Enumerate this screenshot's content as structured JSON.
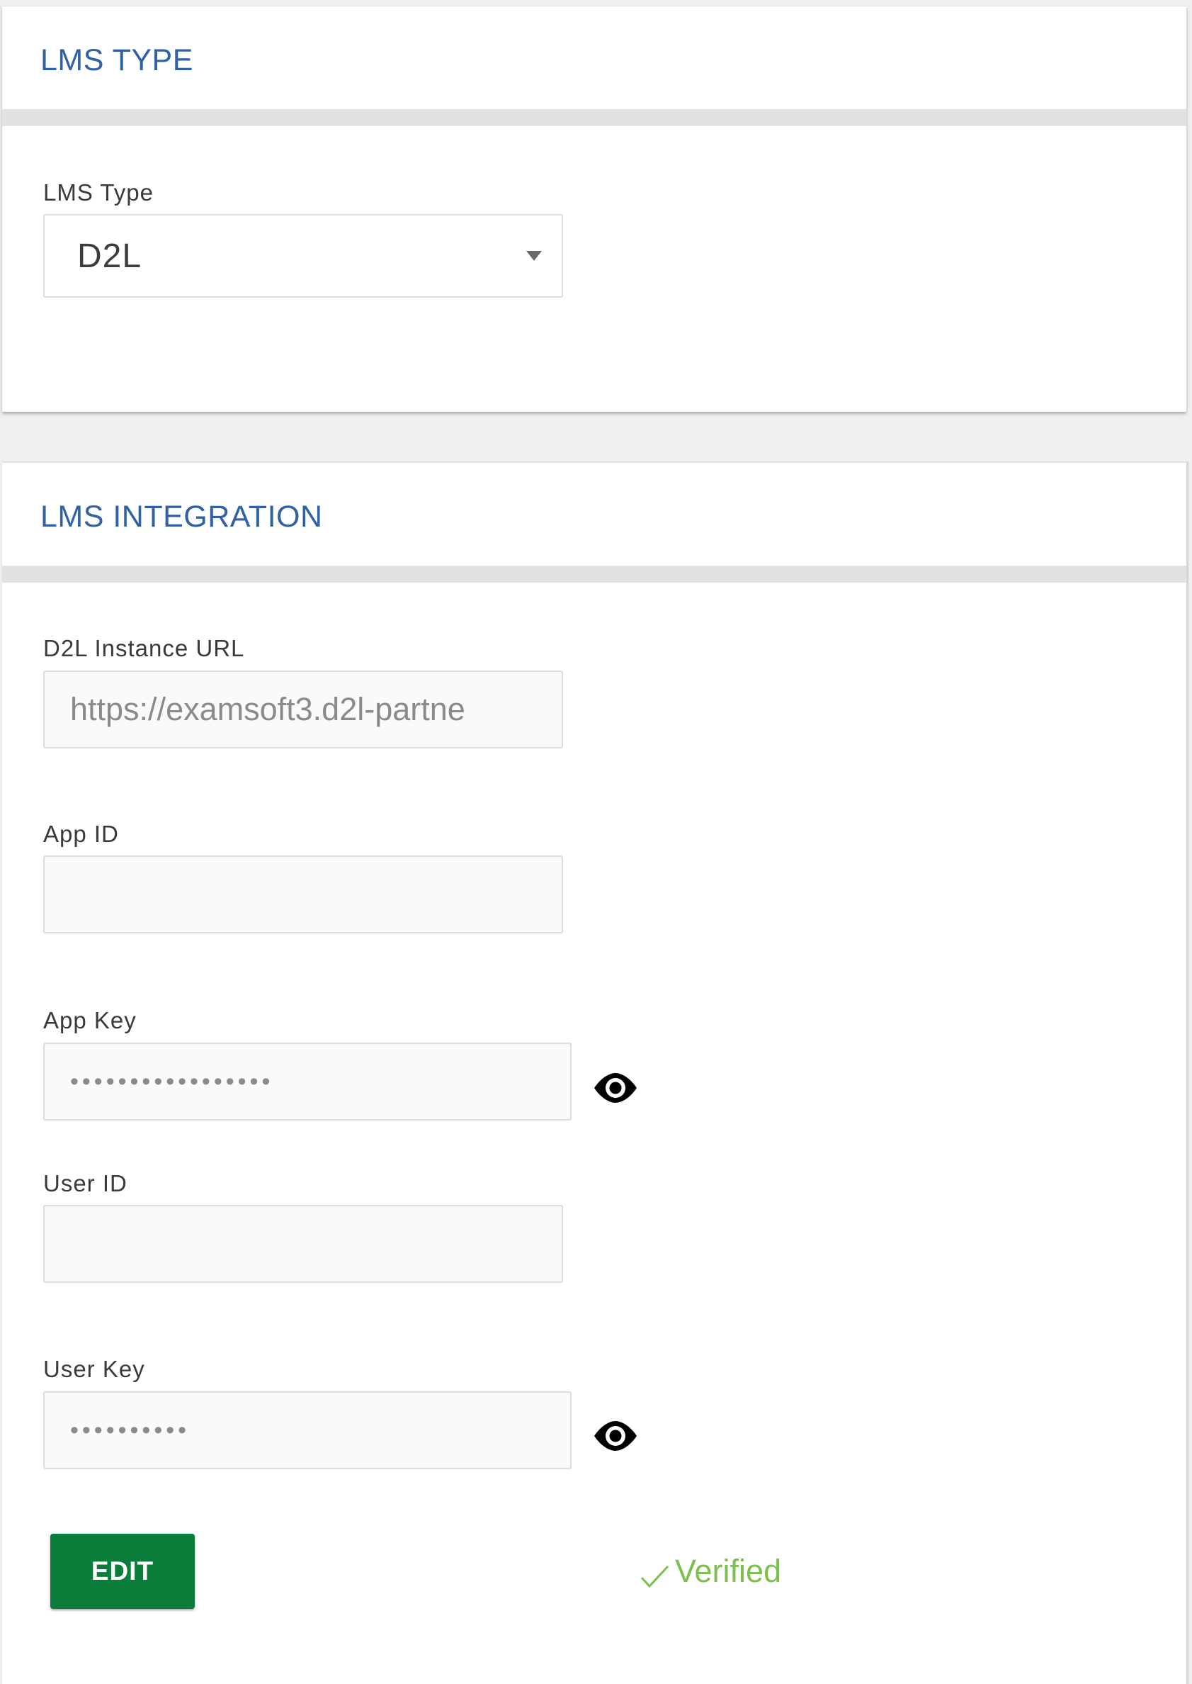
{
  "lms_type_section": {
    "title": "LMS TYPE",
    "field_label": "LMS Type",
    "selected_value": "D2L"
  },
  "lms_integration_section": {
    "title": "LMS INTEGRATION",
    "instance_url": {
      "label": "D2L Instance URL",
      "value": "https://examsoft3.d2l-partne"
    },
    "app_id": {
      "label": "App ID",
      "value": ""
    },
    "app_key": {
      "label": "App Key",
      "masked_value": "•••••••••••••••••"
    },
    "user_id": {
      "label": "User ID",
      "value": ""
    },
    "user_key": {
      "label": "User Key",
      "masked_value": "••••••••••"
    },
    "edit_button_label": "EDIT",
    "status_text": "Verified"
  },
  "icons": {
    "select_caret": "caret-down-icon",
    "show_password": "eye-icon",
    "status": "checkmark-icon"
  },
  "colors": {
    "section_title": "#2f61a3",
    "edit_button": "#0a7d3b",
    "verified": "#7bbf4e"
  }
}
